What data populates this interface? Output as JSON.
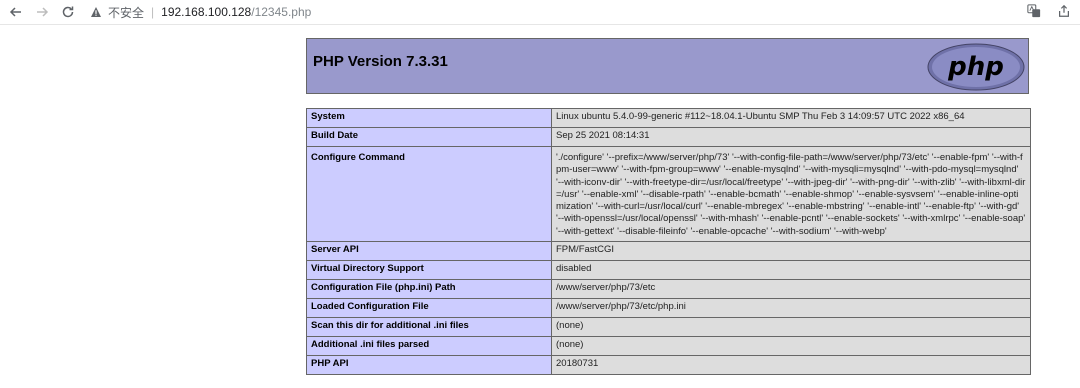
{
  "browser": {
    "security_label": "不安全",
    "url_host": "192.168.100.128",
    "url_path": "/12345.php"
  },
  "header": {
    "title": "PHP Version 7.3.31",
    "logo_text": "php"
  },
  "rows": [
    {
      "key": "System",
      "value": "Linux ubuntu 5.4.0-99-generic #112~18.04.1-Ubuntu SMP Thu Feb 3 14:09:57 UTC 2022 x86_64"
    },
    {
      "key": "Build Date",
      "value": "Sep 25 2021 08:14:31"
    },
    {
      "key": "Configure Command",
      "value": "'./configure' '--prefix=/www/server/php/73' '--with-config-file-path=/www/server/php/73/etc' '--enable-fpm' '--with-fpm-user=www' '--with-fpm-group=www' '--enable-mysqlnd' '--with-mysqli=mysqlnd' '--with-pdo-mysql=mysqlnd' '--with-iconv-dir' '--with-freetype-dir=/usr/local/freetype' '--with-jpeg-dir' '--with-png-dir' '--with-zlib' '--with-libxml-dir=/usr' '--enable-xml' '--disable-rpath' '--enable-bcmath' '--enable-shmop' '--enable-sysvsem' '--enable-inline-optimization' '--with-curl=/usr/local/curl' '--enable-mbregex' '--enable-mbstring' '--enable-intl' '--enable-ftp' '--with-gd' '--with-openssl=/usr/local/openssl' '--with-mhash' '--enable-pcntl' '--enable-sockets' '--with-xmlrpc' '--enable-soap' '--with-gettext' '--disable-fileinfo' '--enable-opcache' '--with-sodium' '--with-webp'"
    },
    {
      "key": "Server API",
      "value": "FPM/FastCGI"
    },
    {
      "key": "Virtual Directory Support",
      "value": "disabled"
    },
    {
      "key": "Configuration File (php.ini) Path",
      "value": "/www/server/php/73/etc"
    },
    {
      "key": "Loaded Configuration File",
      "value": "/www/server/php/73/etc/php.ini"
    },
    {
      "key": "Scan this dir for additional .ini files",
      "value": "(none)"
    },
    {
      "key": "Additional .ini files parsed",
      "value": "(none)"
    },
    {
      "key": "PHP API",
      "value": "20180731"
    }
  ]
}
